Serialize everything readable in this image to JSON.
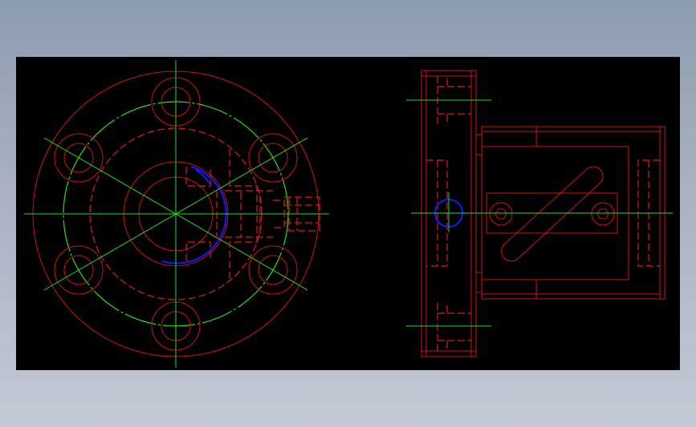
{
  "colors": {
    "background_top": "#8e9cb0",
    "background_bottom": "#c4c9d5",
    "drawing_area": "#000000",
    "outline": "#d01010",
    "hidden_line": "#e01818",
    "center_line": "#22dd22",
    "highlight_circle": "#1818ff"
  },
  "views": [
    {
      "name": "front-view-flange",
      "bolt_holes": 6
    },
    {
      "name": "side-view-assembly"
    }
  ]
}
